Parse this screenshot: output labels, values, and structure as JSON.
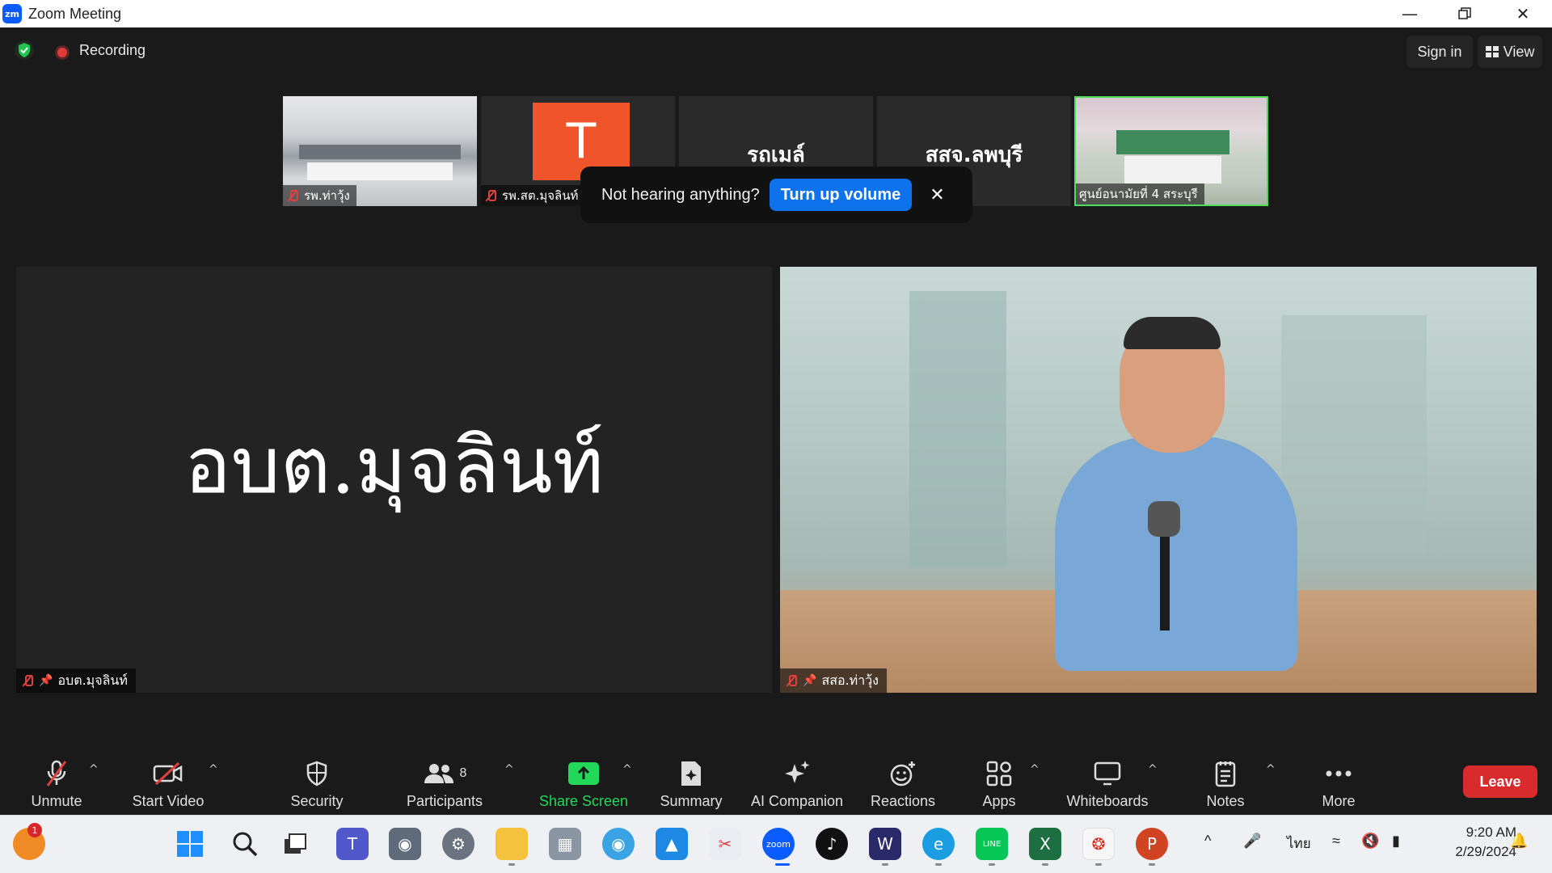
{
  "window": {
    "title": "Zoom Meeting",
    "app_logo": "zm"
  },
  "header": {
    "recording_label": "Recording",
    "sign_in": "Sign in",
    "view": "View"
  },
  "thumbnails": [
    {
      "name": "รพ.ท่าวุ้ง",
      "muted": true
    },
    {
      "name": "รพ.สต.มุจลินท์",
      "avatar": "T",
      "muted": true
    },
    {
      "name": "รถเมล์",
      "muted": false
    },
    {
      "name": "สสจ.ลพบุรี",
      "muted": false
    },
    {
      "name": "ศูนย์อนามัยที่ 4 สระบุรี",
      "muted": false,
      "active_speaker": true
    }
  ],
  "toast": {
    "message": "Not hearing anything?",
    "button": "Turn up volume"
  },
  "tiles": {
    "left": {
      "display_name": "อบต.มุจลินท์",
      "label": "อบต.มุจลินท์"
    },
    "right": {
      "label": "สสอ.ท่าวุ้ง"
    }
  },
  "toolbar": {
    "unmute": "Unmute",
    "start_video": "Start Video",
    "security": "Security",
    "participants": "Participants",
    "participants_count": "8",
    "share_screen": "Share Screen",
    "summary": "Summary",
    "ai_companion": "AI Companion",
    "reactions": "Reactions",
    "apps": "Apps",
    "whiteboards": "Whiteboards",
    "notes": "Notes",
    "more": "More",
    "leave": "Leave"
  },
  "taskbar": {
    "notification_badge": "1",
    "language": "ไทย",
    "time": "9:20 AM",
    "date": "2/29/2024"
  },
  "colors": {
    "accent": "#0e72ed",
    "leave": "#d92b2b",
    "share": "#23d959",
    "muted": "#e04040"
  }
}
